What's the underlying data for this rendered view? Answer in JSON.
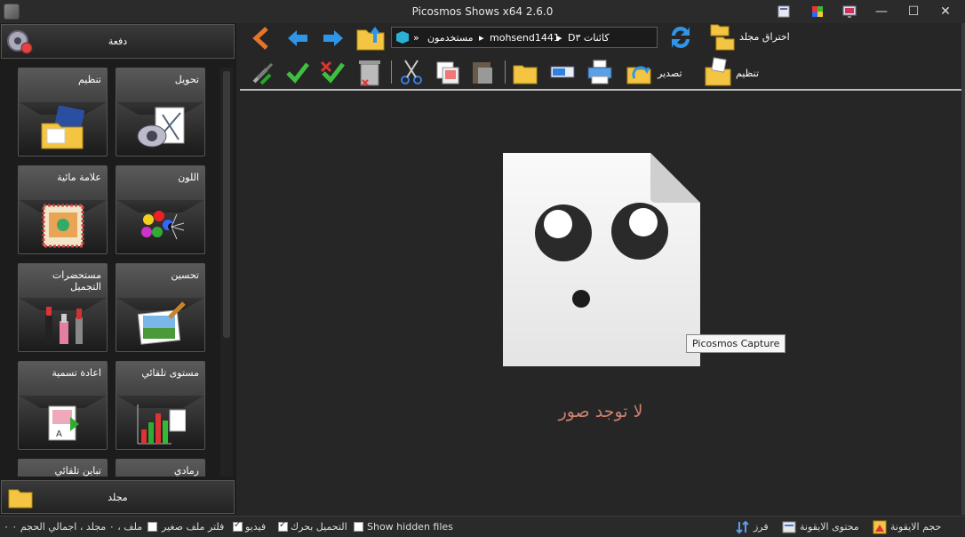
{
  "window": {
    "title": "Picosmos Shows x64 2.6.0"
  },
  "left": {
    "batch_label": "دفعة",
    "folder_label": "مجلد",
    "tiles": [
      {
        "label": "تحويل",
        "icon": "convert-icon"
      },
      {
        "label": "تنظيم",
        "icon": "organize-folder-icon"
      },
      {
        "label": "اللون",
        "icon": "color-balls-icon"
      },
      {
        "label": "علامة مائية",
        "icon": "watermark-stamp-icon"
      },
      {
        "label": "تحسين",
        "icon": "enhance-brush-icon"
      },
      {
        "label": "مستحضرات التجميل",
        "icon": "lipstick-icon"
      },
      {
        "label": "مستوى تلقائي",
        "icon": "auto-level-chart-icon"
      },
      {
        "label": "اعادة تسمية",
        "icon": "rename-icon"
      },
      {
        "label": "رمادي",
        "icon": "gray-icon"
      },
      {
        "label": "تباين تلقائي",
        "icon": "auto-contrast-icon"
      }
    ]
  },
  "toolbar": {
    "path": {
      "root": "Dكائنات ٣",
      "user": "mohsend1441",
      "users": "مستخدمون",
      "more": "»"
    },
    "folder_traverse_label": "اختراق مجلد",
    "export_label": "تصدير",
    "organize_label": "تنظيم"
  },
  "content": {
    "empty_message": "لا توجد صور",
    "tooltip": "Picosmos Capture"
  },
  "status": {
    "summary": "ملف ، ٠ مجلد ، اجمالي الحجم ٠ ٠",
    "small_file_filter": "فلتر ملف صغير",
    "video": "فيديو",
    "lazy_load": "التحميل بحرك",
    "show_hidden": "Show hidden files",
    "sort": "فرز",
    "icon_content": "محتوى الايقونة",
    "icon_size": "حجم الايقونة",
    "checks": {
      "small_file_filter": false,
      "video": true,
      "lazy_load": true,
      "show_hidden": false
    }
  }
}
